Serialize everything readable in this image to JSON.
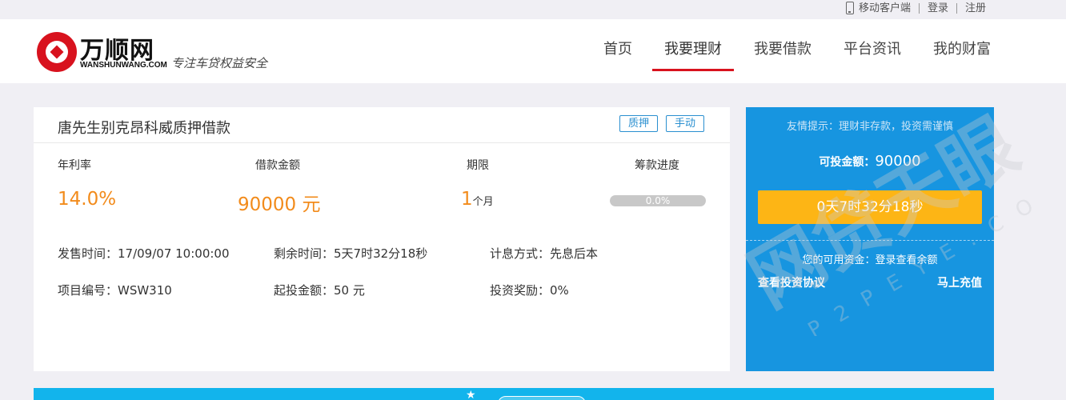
{
  "topbar": {
    "mobile_client": "移动客户端",
    "login": "登录",
    "register": "注册"
  },
  "logo": {
    "name_cn": "万顺网",
    "name_en": "WANSHUNWANG.COM",
    "slogan": "专注车贷权益安全"
  },
  "nav": {
    "items": [
      "首页",
      "我要理财",
      "我要借款",
      "平台资讯",
      "我的财富"
    ],
    "active_index": 1
  },
  "loan": {
    "title": "唐先生别克昂科威质押借款",
    "tags": [
      "质押",
      "手动"
    ],
    "labels": {
      "rate": "年利率",
      "amount": "借款金额",
      "term": "期限",
      "progress": "筹款进度"
    },
    "rate": "14.0%",
    "amount": "90000 元",
    "term_value": "1",
    "term_unit": "个月",
    "progress_text": "0.0%",
    "progress_fraction": 0.0,
    "info": {
      "sale_time": "发售时间：17/09/07 10:00:00",
      "remaining": "剩余时间：5天7时32分18秒",
      "interest_method": "计息方式：先息后本",
      "project_no": "项目编号：WSW310",
      "min_invest": "起投金额：50 元",
      "reward": "投资奖励：0%"
    }
  },
  "side": {
    "tip": "友情提示：理财非存款，投资需谨慎",
    "investable_label": "可投金额：",
    "investable_value": "90000",
    "countdown": "0天7时32分18秒",
    "balance": "您的可用资金：登录查看余额",
    "agreement": "查看投资协议",
    "recharge": "马上充值"
  },
  "watermark": {
    "text": "网贷天眼",
    "url": "P2PEYE.COM"
  },
  "colors": {
    "brand_red": "#d8121e",
    "accent_orange": "#f28b1b",
    "side_blue": "#1795e0",
    "button_yellow": "#fdb515",
    "tag_blue": "#2a8fd0"
  }
}
